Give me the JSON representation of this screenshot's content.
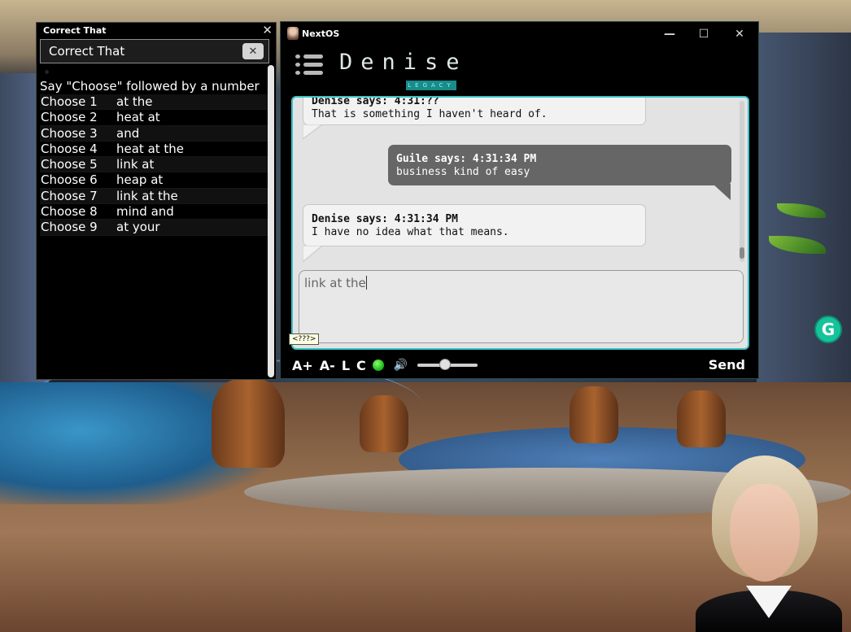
{
  "correct_that": {
    "title": "Correct That",
    "input_value": "Correct That",
    "clear_label": "✕",
    "close_label": "✕",
    "instruction": "Say \"Choose\" followed by a number",
    "choices": [
      {
        "label": "Choose 1",
        "text": "at the"
      },
      {
        "label": "Choose 2",
        "text": "heat at"
      },
      {
        "label": "Choose 3",
        "text": "and"
      },
      {
        "label": "Choose 4",
        "text": "heat at the"
      },
      {
        "label": "Choose 5",
        "text": "link at"
      },
      {
        "label": "Choose 6",
        "text": "heap at"
      },
      {
        "label": "Choose 7",
        "text": "link at the"
      },
      {
        "label": "Choose 8",
        "text": "mind and"
      },
      {
        "label": "Choose 9",
        "text": "at your"
      }
    ]
  },
  "nextos": {
    "title": "NextOS",
    "min_label": "—",
    "max_label": "☐",
    "close_label": "✕",
    "logo": "Denise",
    "logo_sub": "LEGACY",
    "messages": [
      {
        "header": "Denise says: 4:31:??",
        "body": "That is something I haven't heard of.",
        "from": "denise"
      },
      {
        "header": "Guile says: 4:31:34 PM",
        "body": "business kind of easy",
        "from": "guile"
      },
      {
        "header": "Denise says: 4:31:34 PM",
        "body": "I have no idea what that means.",
        "from": "denise"
      }
    ],
    "input_value": "link at the",
    "tooltip": "<???>",
    "footer": {
      "font_up": "A+",
      "font_down": "A-",
      "log": "L",
      "clear": "C",
      "status_color": "#12b212",
      "speaker_icon": "🔊",
      "volume_level": 0.45,
      "send": "Send"
    }
  },
  "grammarly_label": "G"
}
